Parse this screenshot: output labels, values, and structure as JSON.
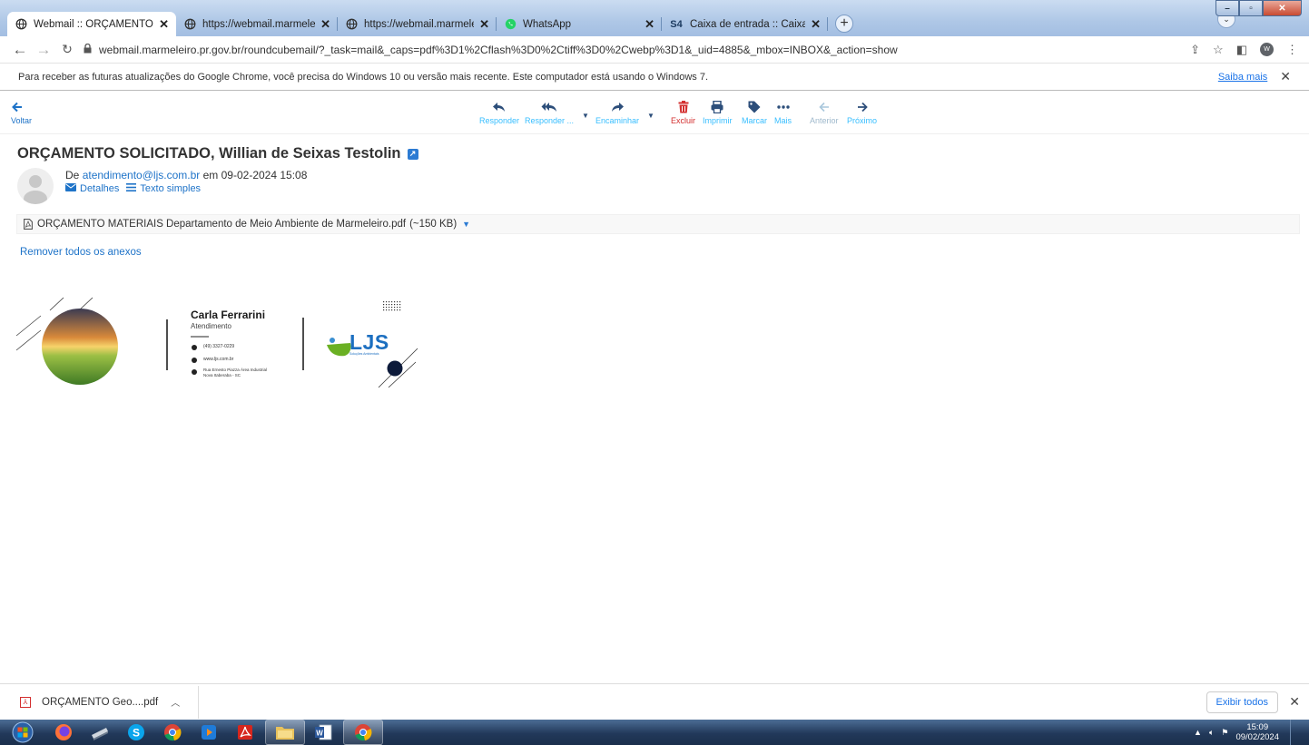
{
  "tabs": [
    {
      "title": "Webmail :: ORÇAMENTO SOLICITADO",
      "active": true,
      "icon": "globe-icon"
    },
    {
      "title": "https://webmail.marmeleiro.pr.gov.br",
      "active": false,
      "icon": "globe-icon"
    },
    {
      "title": "https://webmail.marmeleiro.pr.gov.br",
      "active": false,
      "icon": "globe-icon"
    },
    {
      "title": "WhatsApp",
      "active": false,
      "icon": "whatsapp-icon"
    },
    {
      "title": "Caixa de entrada :: Caixa de entrada",
      "active": false,
      "icon": "s4-icon"
    }
  ],
  "address_bar": {
    "url": "webmail.marmeleiro.pr.gov.br/roundcubemail/?_task=mail&_caps=pdf%3D1%2Cflash%3D0%2Ctiff%3D0%2Cwebp%3D1&_uid=4885&_mbox=INBOX&_action=show",
    "profile_initial": "W"
  },
  "infobar": {
    "message": "Para receber as futuras atualizações do Google Chrome, você precisa do Windows 10 ou versão mais recente. Este computador está usando o Windows 7.",
    "link": "Saiba mais"
  },
  "mail_toolbar": {
    "back": "Voltar",
    "reply": "Responder",
    "reply_all": "Responder ...",
    "forward": "Encaminhar",
    "delete": "Excluir",
    "print": "Imprimir",
    "mark": "Marcar",
    "more": "Mais",
    "previous": "Anterior",
    "next": "Próximo"
  },
  "message": {
    "subject": "ORÇAMENTO SOLICITADO, Willian de Seixas Testolin",
    "from_prefix": "De",
    "from_email": "atendimento@ljs.com.br",
    "date_prefix": "em",
    "date": "09-02-2024 15:08",
    "details_link": "Detalhes",
    "plain_text_link": "Texto simples",
    "attachment": "ORÇAMENTO MATERIAIS Departamento de Meio Ambiente de Marmeleiro.pdf",
    "attachment_size": "(~150 KB)",
    "remove_all": "Remover todos os anexos"
  },
  "signature": {
    "name": "Carla Ferrarini",
    "role": "Atendimento",
    "phone": "(49) 3327-0229",
    "website": "www.ljs.com.br",
    "address_line1": "Rua Ernesto Piazza Área Industrial",
    "address_line2": "Nova Itaberaba - SC",
    "logo_text": "LJS",
    "logo_sub": "Soluções Ambientais"
  },
  "download_bar": {
    "file": "ORÇAMENTO Geo....pdf",
    "show_all": "Exibir todos"
  },
  "taskbar": {
    "time": "15:09",
    "date": "09/02/2024"
  }
}
